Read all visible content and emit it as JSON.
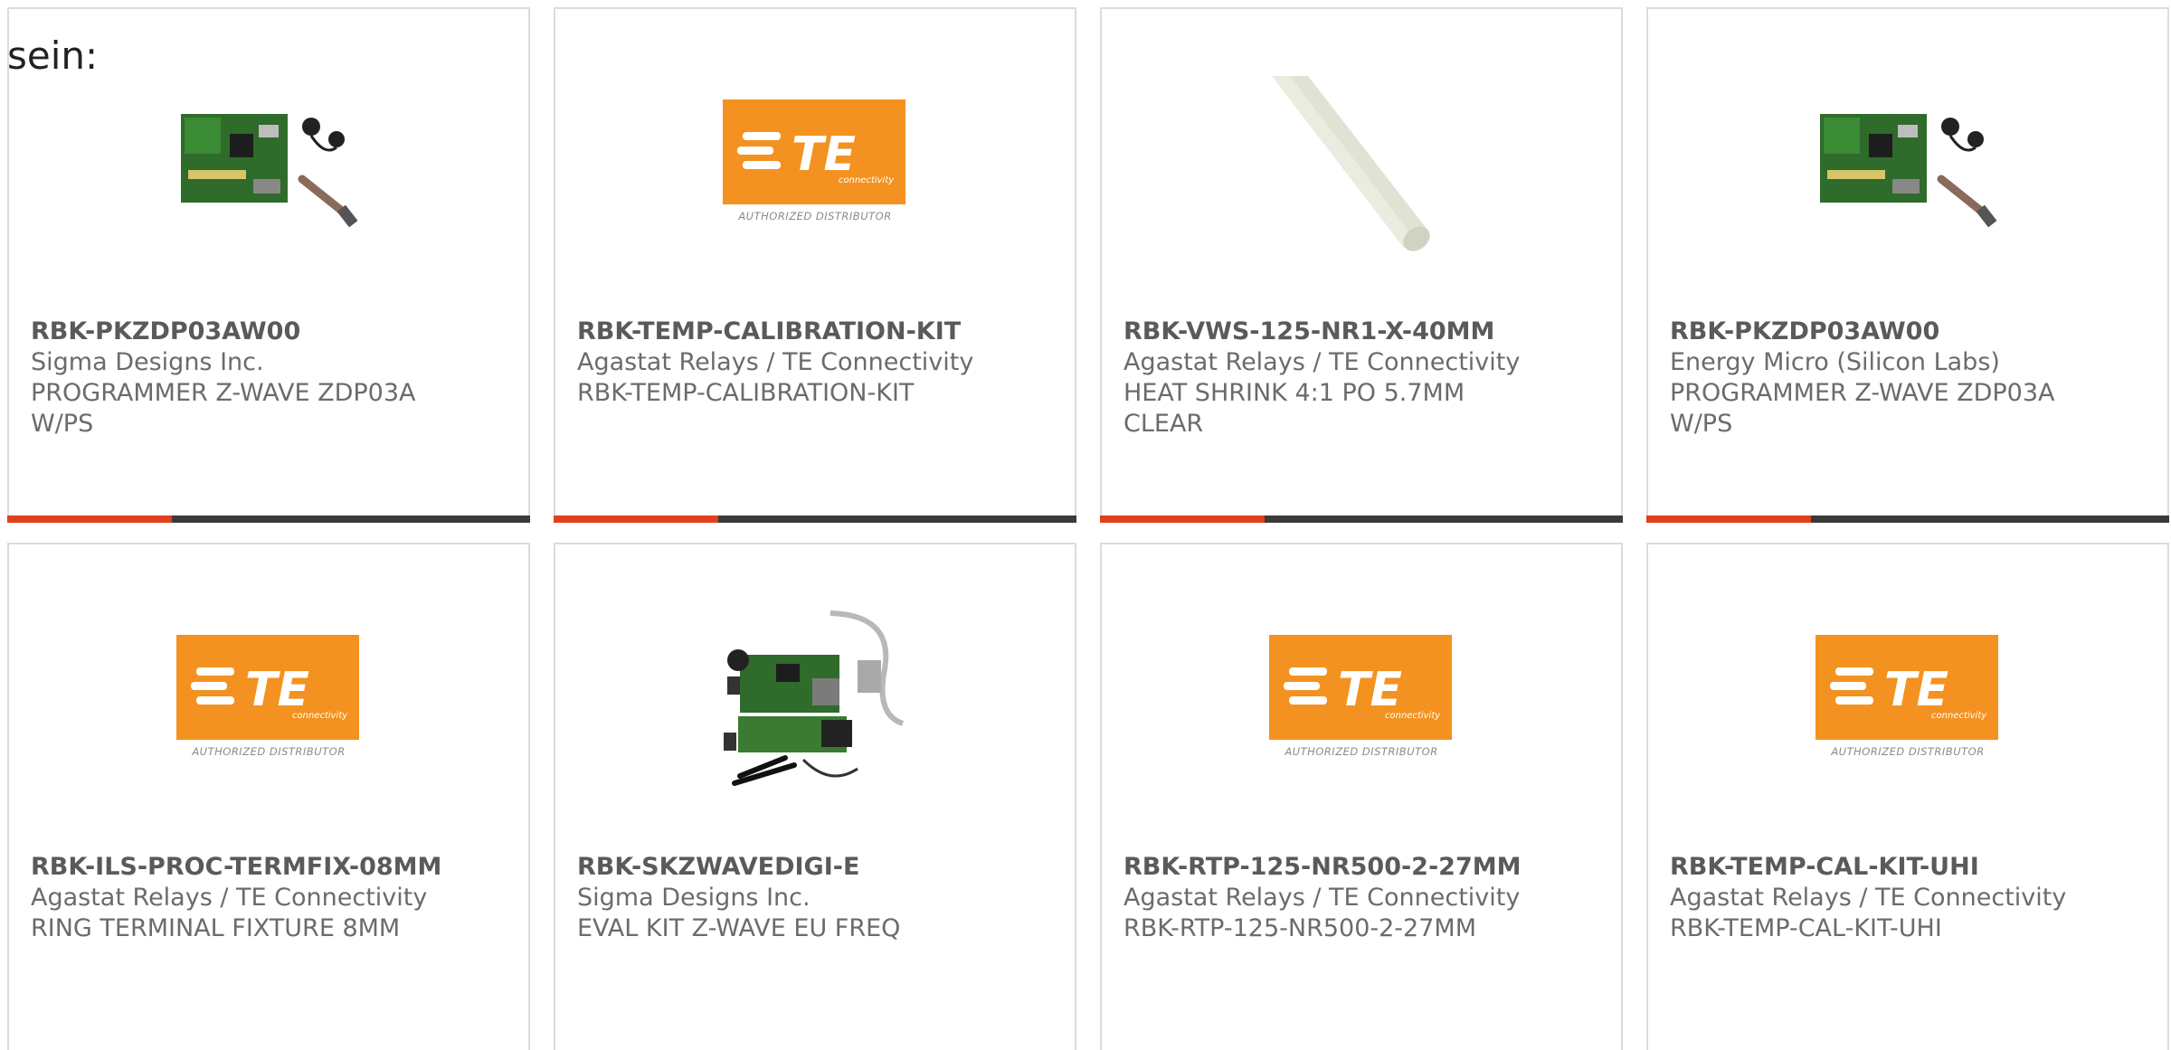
{
  "intro_text": "sein:",
  "colors": {
    "accent": "#e0401c",
    "bar": "#3a3a3a",
    "te_orange": "#f39220",
    "text": "#6b6b6b"
  },
  "te_logo": {
    "wordmark": "TE",
    "sub": "connectivity",
    "distributor": "AUTHORIZED DISTRIBUTOR"
  },
  "products": [
    {
      "image": "programmer-board-image",
      "part_number": "RBK-PKZDP03AW00",
      "manufacturer": "Sigma Designs Inc.",
      "description": "PROGRAMMER Z-WAVE ZDP03A\nW/PS"
    },
    {
      "image": "te-logo",
      "part_number": "RBK-TEMP-CALIBRATION-KIT",
      "manufacturer": "Agastat Relays / TE Connectivity",
      "description": "RBK-TEMP-CALIBRATION-KIT"
    },
    {
      "image": "heat-shrink-tube-image",
      "part_number": "RBK-VWS-125-NR1-X-40MM",
      "manufacturer": "Agastat Relays / TE Connectivity",
      "description": "HEAT SHRINK 4:1 PO 5.7MM\nCLEAR"
    },
    {
      "image": "programmer-board-image",
      "part_number": "RBK-PKZDP03AW00",
      "manufacturer": "Energy Micro (Silicon Labs)",
      "description": "PROGRAMMER Z-WAVE ZDP03A\nW/PS"
    },
    {
      "image": "te-logo",
      "part_number": "RBK-ILS-PROC-TERMFIX-08MM",
      "manufacturer": "Agastat Relays / TE Connectivity",
      "description": "RING TERMINAL FIXTURE 8MM"
    },
    {
      "image": "eval-kit-image",
      "part_number": "RBK-SKZWAVEDIGI-E",
      "manufacturer": "Sigma Designs Inc.",
      "description": "EVAL KIT Z-WAVE EU FREQ"
    },
    {
      "image": "te-logo",
      "part_number": "RBK-RTP-125-NR500-2-27MM",
      "manufacturer": "Agastat Relays / TE Connectivity",
      "description": "RBK-RTP-125-NR500-2-27MM"
    },
    {
      "image": "te-logo",
      "part_number": "RBK-TEMP-CAL-KIT-UHI",
      "manufacturer": "Agastat Relays / TE Connectivity",
      "description": "RBK-TEMP-CAL-KIT-UHI"
    }
  ]
}
